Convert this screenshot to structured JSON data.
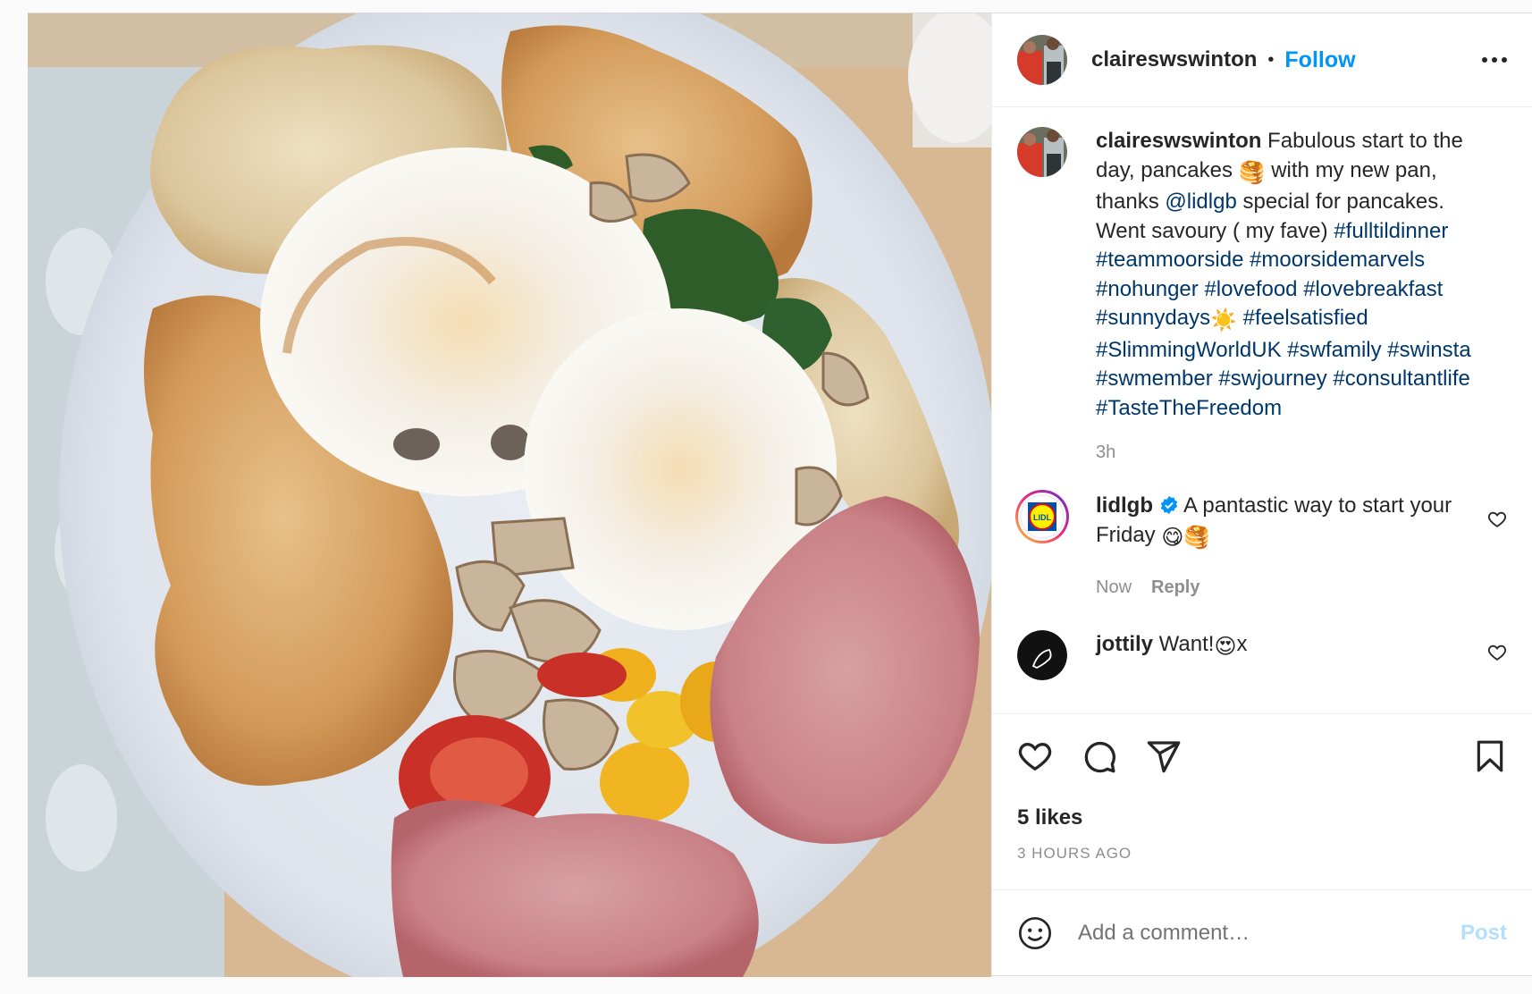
{
  "header": {
    "username": "claireswswinton",
    "separator": "•",
    "follow_label": "Follow",
    "more_icon": "more-horizontal-icon"
  },
  "caption": {
    "username": "claireswswinton",
    "text_1": " Fabulous start to the day, pancakes ",
    "pancake_emoji": "🥞",
    "text_2": " with my new pan, thanks ",
    "mention": "@lidlgb",
    "text_3": " special for pancakes. Went savoury ( my fave) ",
    "tags_a": "#fulltildinner #teammoorside #moorsidemarvels #nohunger #lovefood #lovebreakfast #sunnydays",
    "sun_emoji": "☀️",
    "tags_b": " #feelsatisfied #SlimmingWorldUK #swfamily #swinsta #swmember #swjourney #consultantlife #TasteTheFreedom",
    "time": "3h"
  },
  "comments": [
    {
      "username": "lidlgb",
      "verified": true,
      "text": " A pantastic way to start your Friday ",
      "emoji": "😋🥞",
      "time": "Now",
      "reply_label": "Reply"
    },
    {
      "username": "jottily",
      "text": " Want!",
      "emoji": "😍",
      "text_end": "x"
    }
  ],
  "actions": {
    "like_icon": "heart-icon",
    "comment_icon": "comment-icon",
    "share_icon": "paper-plane-icon",
    "save_icon": "bookmark-icon"
  },
  "likes": "5 likes",
  "timestamp": "3 HOURS AGO",
  "add_comment": {
    "placeholder": "Add a comment…",
    "post_label": "Post"
  },
  "lidl_logo_text": "LIDL"
}
